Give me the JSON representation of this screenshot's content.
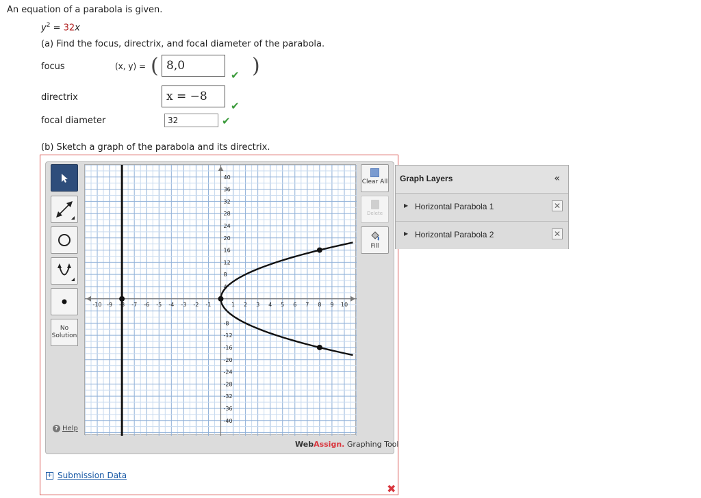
{
  "prompt": {
    "intro": "An equation of a parabola is given."
  },
  "equation": {
    "lhs_var": "y",
    "exp": "2",
    "equals": " = ",
    "coef": "32",
    "rhs_var": "x"
  },
  "part_a": {
    "prompt": "(a) Find the focus, directrix, and focal diameter of the parabola.",
    "focus": {
      "label": "focus",
      "coord_label": "(x, y) =",
      "value": "8,0",
      "open_paren": "(",
      "close_paren": ")"
    },
    "directrix": {
      "label": "directrix",
      "value": "x = −8"
    },
    "focal_diameter": {
      "label": "focal diameter",
      "value": "32"
    },
    "check": "✔"
  },
  "part_b": {
    "prompt": "(b) Sketch a graph of the parabola and its directrix."
  },
  "tools": {
    "no_solution": "No Solution",
    "help": "Help"
  },
  "right_buttons": {
    "clear_all": "Clear All",
    "delete": "Delete",
    "fill": "Fill"
  },
  "branding": {
    "web": "Web",
    "assign": "Assign.",
    "tool": " Graphing Tool"
  },
  "layers": {
    "header": "Graph Layers",
    "collapse": "«",
    "items": [
      {
        "label": "Horizontal Parabola 1"
      },
      {
        "label": "Horizontal Parabola 2"
      }
    ]
  },
  "submission": {
    "label": "Submission Data",
    "result_mark": "✖"
  },
  "chart_data": {
    "type": "line",
    "x_ticks": [
      "-10",
      "-9",
      "-8",
      "-7",
      "-6",
      "-5",
      "-4",
      "-3",
      "-2",
      "-1",
      "1",
      "2",
      "3",
      "4",
      "5",
      "6",
      "7",
      "8",
      "9",
      "10"
    ],
    "y_ticks": [
      "40",
      "36",
      "32",
      "28",
      "24",
      "20",
      "16",
      "12",
      "8",
      "4",
      "-8",
      "-12",
      "-16",
      "-20",
      "-24",
      "-28",
      "-32",
      "-36",
      "-40"
    ],
    "xlim": [
      -11,
      11
    ],
    "ylim": [
      -45,
      44
    ],
    "grid": true,
    "series": [
      {
        "name": "Horizontal Parabola 1",
        "shape": "y^2 = 32x",
        "points": [
          [
            0,
            0
          ],
          [
            8,
            16
          ],
          [
            8,
            -16
          ]
        ]
      },
      {
        "name": "Horizontal Parabola 2",
        "shape": "x = -8",
        "points": [
          [
            -8,
            0
          ]
        ]
      }
    ]
  },
  "colors": {
    "check_green": "#3a9a3a",
    "error_red": "#d9363e",
    "link_blue": "#1a5aa6",
    "active_tool": "#2e4d7b"
  }
}
